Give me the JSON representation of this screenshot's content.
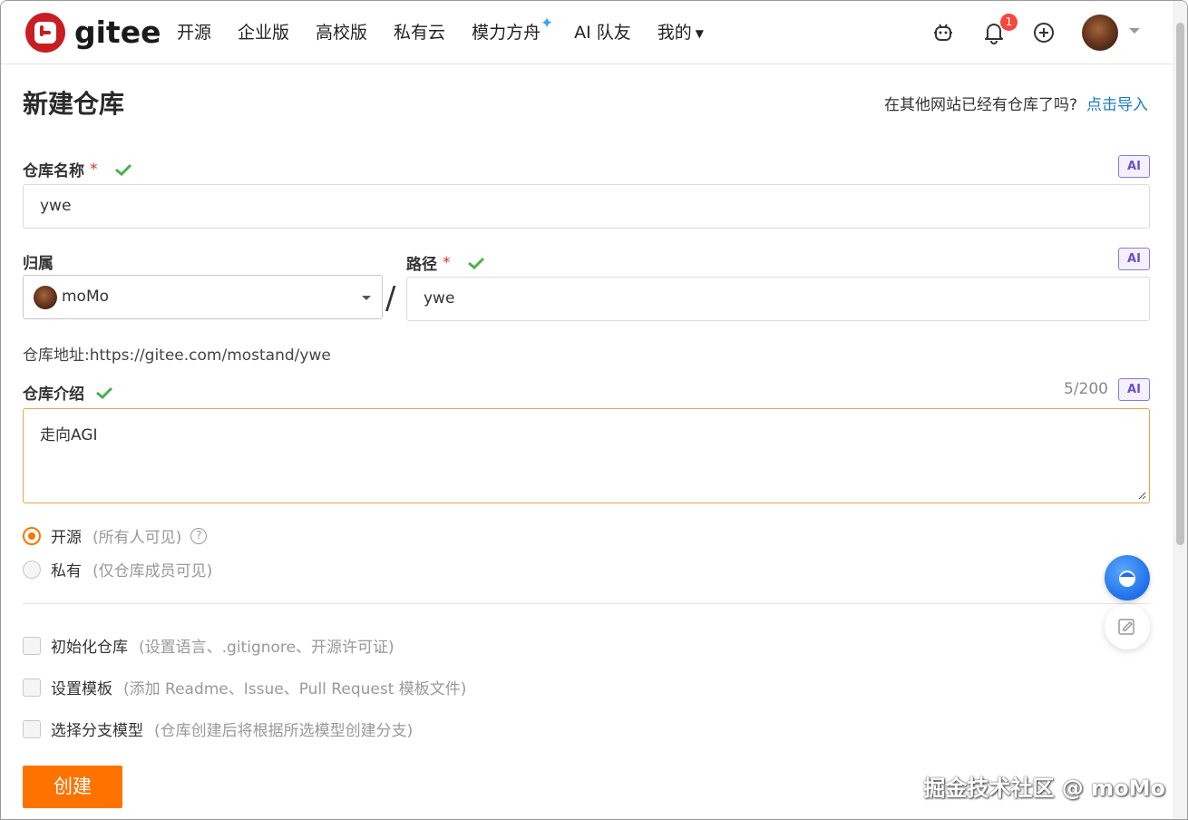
{
  "header": {
    "brand": "gitee",
    "nav": [
      {
        "label": "开源"
      },
      {
        "label": "企业版"
      },
      {
        "label": "高校版"
      },
      {
        "label": "私有云"
      },
      {
        "label": "模力方舟"
      },
      {
        "label": "AI 队友"
      },
      {
        "label": "我的"
      }
    ],
    "notification_count": "1"
  },
  "page": {
    "title": "新建仓库",
    "import_prompt": "在其他网站已经有仓库了吗?",
    "import_link": "点击导入"
  },
  "form": {
    "ai_label": "AI",
    "repo_name_label": "仓库名称",
    "required_mark": "*",
    "repo_name_value": "ywe",
    "owner_label": "归属",
    "owner_value": "moMo",
    "path_label": "路径",
    "path_value": "ywe",
    "slash": "/",
    "repo_url": "仓库地址:https://gitee.com/mostand/ywe",
    "intro_label": "仓库介绍",
    "intro_counter": "5/200",
    "intro_value": "走向AGI",
    "visibility": [
      {
        "label": "开源",
        "hint": "(所有人可见)",
        "selected": true
      },
      {
        "label": "私有",
        "hint": "(仅仓库成员可见)",
        "selected": false
      }
    ],
    "options": [
      {
        "label": "初始化仓库",
        "hint": "(设置语言、.gitignore、开源许可证)",
        "checked": false
      },
      {
        "label": "设置模板",
        "hint": "(添加 Readme、Issue、Pull Request 模板文件)",
        "checked": false
      },
      {
        "label": "选择分支模型",
        "hint": "(仓库创建后将根据所选模型创建分支)",
        "checked": false
      }
    ],
    "submit_label": "创建"
  },
  "watermark": "掘金技术社区 @ moMo",
  "colors": {
    "brand_red": "#c71d23",
    "accent_orange": "#fe7300",
    "link_blue": "#1a7fc1",
    "success_green": "#4caf50"
  }
}
